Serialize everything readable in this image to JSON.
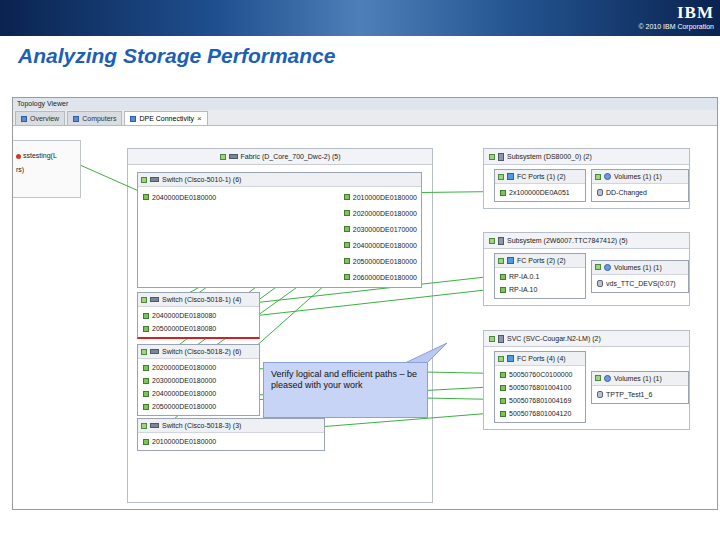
{
  "banner": {
    "logo": "IBM",
    "copyright": "© 2010 IBM Corporation"
  },
  "slide": {
    "title": "Analyzing Storage Performance"
  },
  "window": {
    "title": "Topology Viewer"
  },
  "tabs": [
    {
      "label": "Overview",
      "selected": false
    },
    {
      "label": "Computers",
      "selected": false
    },
    {
      "label": "DPE Connectivity",
      "selected": true
    }
  ],
  "tab_close": "×",
  "host": {
    "lines": [
      "sstesting(L",
      "rs)"
    ]
  },
  "fabric": {
    "header": "Fabric (D_Core_700_Dwc-2) (5)",
    "switches": [
      {
        "header": "Switch (Cisco-5010-1) (6)",
        "highlighted": false,
        "ports": [
          "2040000DE0180000",
          "2010000DE0180000",
          "2020000DE0180000",
          "2030000DE0170000",
          "2040000DE0180000",
          "2050000DE0180000",
          "2060000DE0180000"
        ]
      },
      {
        "header": "Switch (Cisco-5018-1) (4)",
        "highlighted": true,
        "ports": [
          "2040000DE0180080",
          "2050000DE0180080"
        ]
      },
      {
        "header": "Switch (Cisco-5018-2) (6)",
        "highlighted": false,
        "ports": [
          "2020000DE0180000",
          "2030000DE0180000",
          "2040000DE0180000",
          "2050000DE0180000"
        ]
      },
      {
        "header": "Switch (Cisco-5018-3) (3)",
        "highlighted": false,
        "ports": [
          "2010000DE0180000"
        ]
      }
    ]
  },
  "subsystems": [
    {
      "header": "Subsystem (DS8000_0) (2)",
      "fc_ports": {
        "header": "FC Ports (1) (2)",
        "ports": [
          "2x100000DE0A051"
        ]
      },
      "volumes": {
        "header": "Volumes (1) (1)",
        "items": [
          "DD-Changed"
        ]
      }
    },
    {
      "header": "Subsystem (2W6007.TTC7847412) (5)",
      "fc_ports": {
        "header": "FC Ports (2) (2)",
        "ports": [
          "RP-IA.0.1",
          "RP-IA.10"
        ]
      },
      "volumes": {
        "header": "Volumes (1) (1)",
        "items": [
          "vds_TTC_DEVS(0:07)"
        ]
      }
    },
    {
      "header": "SVC (SVC-Cougar.N2-LM) (2)",
      "fc_ports": {
        "header": "FC Ports (4) (4)",
        "ports": [
          "50050760C0100000",
          "5005076801004100",
          "5005076801004169",
          "5005076801004120"
        ]
      },
      "volumes": {
        "header": "Volumes (1) (1)",
        "items": [
          "TPTP_Test1_6"
        ]
      }
    }
  ],
  "callout": {
    "text": "Verify logical and efficient paths – be pleased with your work"
  }
}
